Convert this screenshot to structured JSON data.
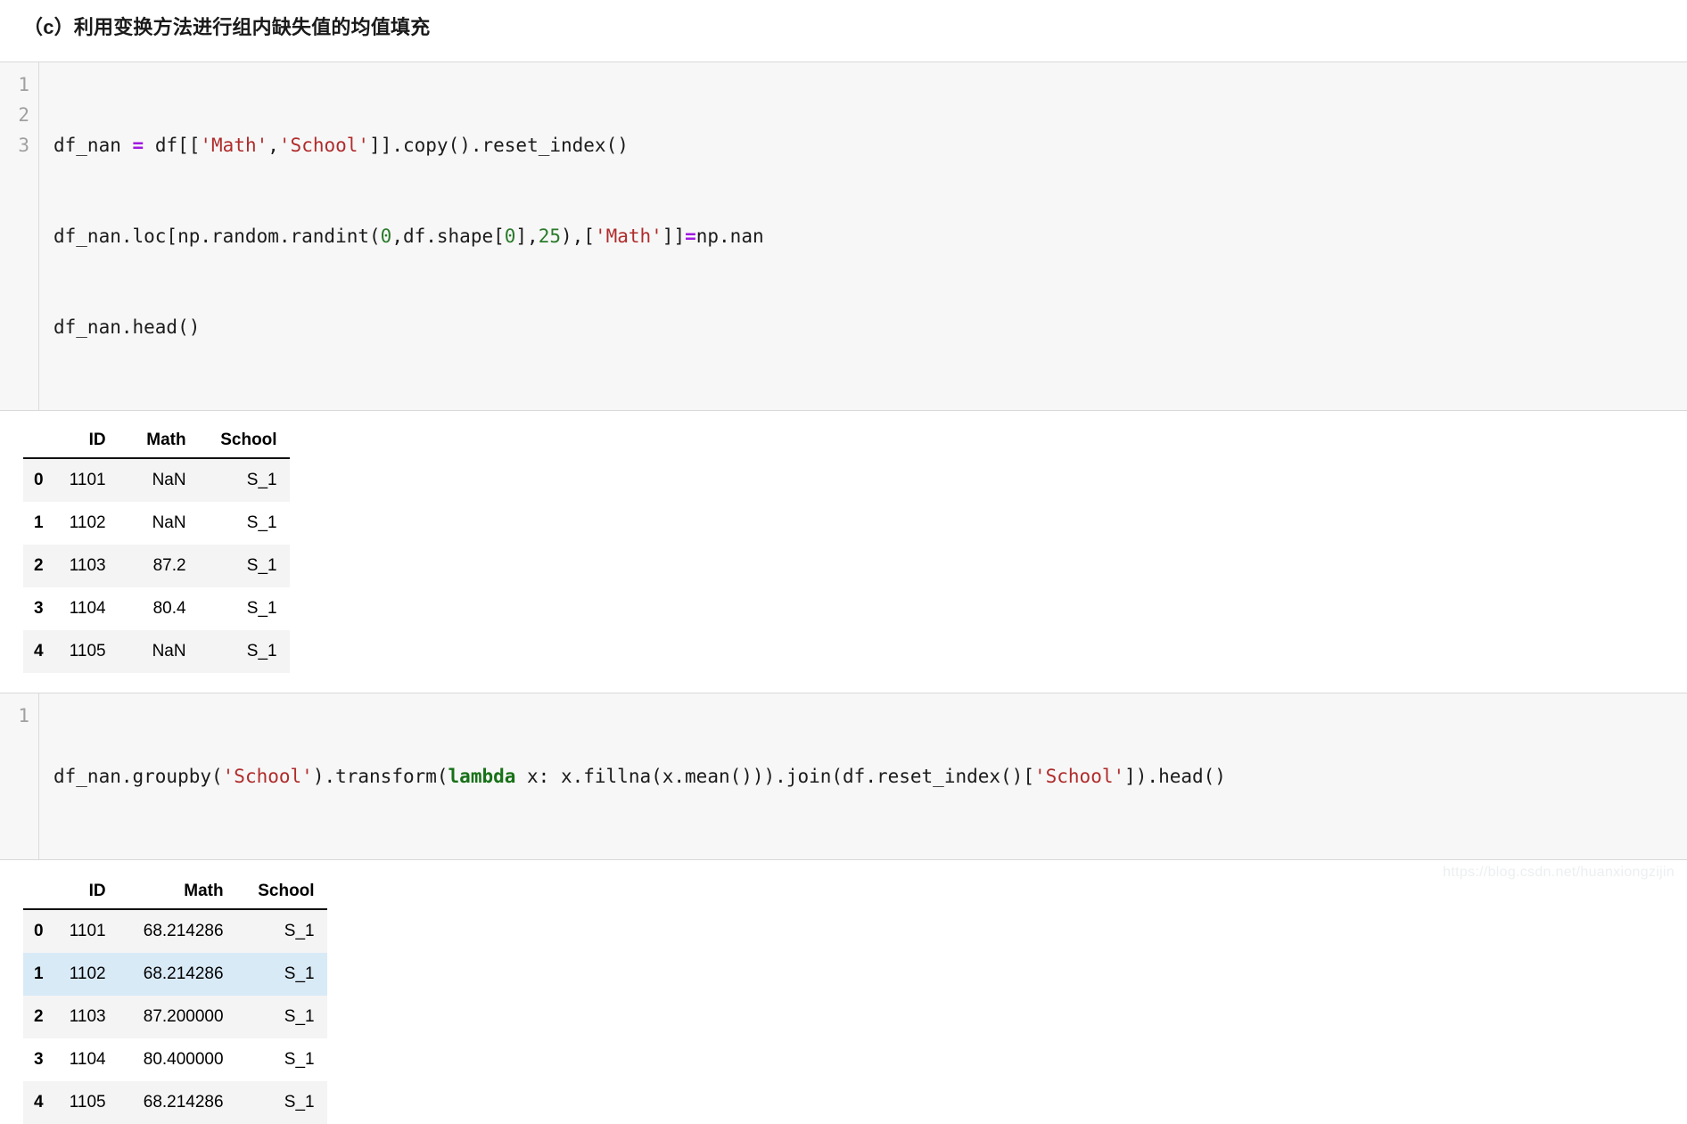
{
  "page": {
    "title": "（c）利用变换方法进行组内缺失值的均值填充",
    "watermark": "https://blog.csdn.net/huanxiongzijin"
  },
  "colors": {
    "string": "#b02b2b",
    "number": "#2a7a2a",
    "operator": "#a018e0",
    "keyword": "#177117",
    "code_background": "#f7f7f7",
    "row_stripe": "#f4f4f4",
    "row_hover": "#d9eaf7"
  },
  "code_cell_1": {
    "line_numbers": [
      "1",
      "2",
      "3"
    ],
    "lines": [
      "df_nan = df[['Math','School']].copy().reset_index()",
      "df_nan.loc[np.random.randint(0,df.shape[0],25),['Math']]=np.nan",
      "df_nan.head()"
    ],
    "l1": {
      "p1": "df_nan ",
      "op": "=",
      "p2": " df[[",
      "s1": "'Math'",
      "p3": ",",
      "s2": "'School'",
      "p4": "]].copy().reset_index()"
    },
    "l2": {
      "p1": "df_nan.loc[np.random.randint(",
      "n1": "0",
      "p2": ",df.shape[",
      "n2": "0",
      "p3": "],",
      "n3": "25",
      "p4": "),[",
      "s1": "'Math'",
      "p5": "]]",
      "op": "=",
      "p6": "np.nan"
    },
    "l3": {
      "p1": "df_nan.head()"
    }
  },
  "table_1": {
    "columns": [
      "",
      "ID",
      "Math",
      "School"
    ],
    "rows": [
      {
        "index": "0",
        "ID": "1101",
        "Math": "NaN",
        "School": "S_1",
        "style": "odd-row"
      },
      {
        "index": "1",
        "ID": "1102",
        "Math": "NaN",
        "School": "S_1",
        "style": "even-row"
      },
      {
        "index": "2",
        "ID": "1103",
        "Math": "87.2",
        "School": "S_1",
        "style": "odd-row"
      },
      {
        "index": "3",
        "ID": "1104",
        "Math": "80.4",
        "School": "S_1",
        "style": "even-row"
      },
      {
        "index": "4",
        "ID": "1105",
        "Math": "NaN",
        "School": "S_1",
        "style": "odd-row"
      }
    ]
  },
  "code_cell_2": {
    "line_numbers": [
      "1"
    ],
    "lines": [
      "df_nan.groupby('School').transform(lambda x: x.fillna(x.mean())).join(df.reset_index()['School']).head()"
    ],
    "l1": {
      "p1": "df_nan.groupby(",
      "s1": "'School'",
      "p2": ").transform(",
      "kw": "lambda",
      "p3": " x: x.fillna(x.mean())).join(df.reset_index()[",
      "s2": "'School'",
      "p4": "]).head()"
    }
  },
  "table_2": {
    "columns": [
      "",
      "ID",
      "Math",
      "School"
    ],
    "rows": [
      {
        "index": "0",
        "ID": "1101",
        "Math": "68.214286",
        "School": "S_1",
        "style": "odd-row"
      },
      {
        "index": "1",
        "ID": "1102",
        "Math": "68.214286",
        "School": "S_1",
        "style": "hover-row"
      },
      {
        "index": "2",
        "ID": "1103",
        "Math": "87.200000",
        "School": "S_1",
        "style": "odd-row"
      },
      {
        "index": "3",
        "ID": "1104",
        "Math": "80.400000",
        "School": "S_1",
        "style": "even-row"
      },
      {
        "index": "4",
        "ID": "1105",
        "Math": "68.214286",
        "School": "S_1",
        "style": "odd-row"
      }
    ]
  }
}
